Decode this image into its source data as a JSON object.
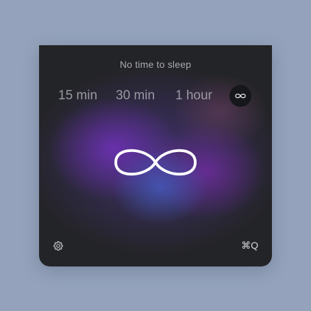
{
  "title": "No time to sleep",
  "durations": [
    {
      "label": "15 min"
    },
    {
      "label": "30 min"
    },
    {
      "label": "1 hour"
    }
  ],
  "selected_option": "infinite",
  "icons": {
    "infinite_option": "infinity-icon",
    "main": "infinity-icon",
    "settings": "gear-icon"
  },
  "quit_shortcut": "⌘Q",
  "colors": {
    "background": "#94a3bb",
    "panel": "#232427",
    "glow_purple": "#7832c8",
    "glow_blue": "#465fc8"
  }
}
